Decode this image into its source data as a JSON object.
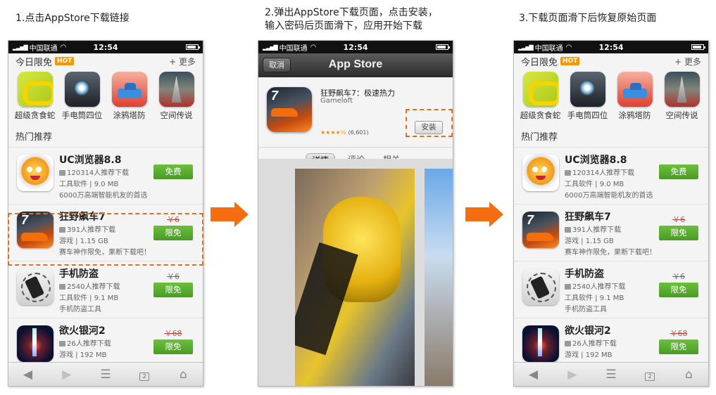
{
  "captions": {
    "step1": "1.点击AppStore下载链接",
    "step2_line1": "2.弹出AppStore下载页面，点击安装，",
    "step2_line2": "输入密码后页面滑下，应用开始下载",
    "step3": "3.下载页面滑下后恢复原始页面"
  },
  "status_bar": {
    "carrier": "中国联通",
    "time": "12:54"
  },
  "free_section": {
    "title": "今日限免",
    "badge": "HOT",
    "more": "+ 更多",
    "apps": [
      {
        "name": "超级贪食蛇",
        "icon": "snake-game-icon"
      },
      {
        "name": "手电筒四位",
        "icon": "flashlight-icon"
      },
      {
        "name": "涂鸦塔防",
        "icon": "tank-tower-defense-icon"
      },
      {
        "name": "空间传说",
        "icon": "space-legend-icon"
      }
    ]
  },
  "hot_section": {
    "title": "热门推荐",
    "apps": [
      {
        "name": "UC浏览器8.8",
        "downloads": "120314人推荐下载",
        "meta": "工具软件 | 9.0 MB",
        "desc": "6000万高端智能机友的首选",
        "old_price": "",
        "button": "免费",
        "icon": "uc-browser-icon"
      },
      {
        "name": "狂野飙车7",
        "downloads": "391人推荐下载",
        "meta": "游戏 | 1.15 GB",
        "desc": "赛车神作限免，果断下载吧！",
        "old_price": "￥6",
        "button": "限免",
        "icon": "racing-game-icon"
      },
      {
        "name": "手机防盗",
        "downloads": "2540人推荐下载",
        "meta": "工具软件 | 9.1 MB",
        "desc": "手机防盗工具",
        "old_price": "￥6",
        "button": "限免",
        "icon": "phone-guard-icon"
      },
      {
        "name": "欲火银河2",
        "downloads": "26人推荐下载",
        "meta": "游戏 | 192 MB",
        "desc": "",
        "old_price": "￥68",
        "button": "限免",
        "icon": "galaxy-game-icon"
      }
    ]
  },
  "toolbar": {
    "tab_count": "2"
  },
  "app_store": {
    "cancel": "取消",
    "title": "App Store",
    "app_title": "狂野飙车7：极速热力",
    "developer": "Gameloft",
    "stars": "★★★★½",
    "rating_count": "(6,601)",
    "install": "安装",
    "tabs": [
      "详情",
      "评论",
      "相关"
    ],
    "active_tab": "详情"
  },
  "colors": {
    "accent_orange": "#f46d10",
    "button_green": "#56ab2f",
    "hot_badge": "#f39800"
  }
}
